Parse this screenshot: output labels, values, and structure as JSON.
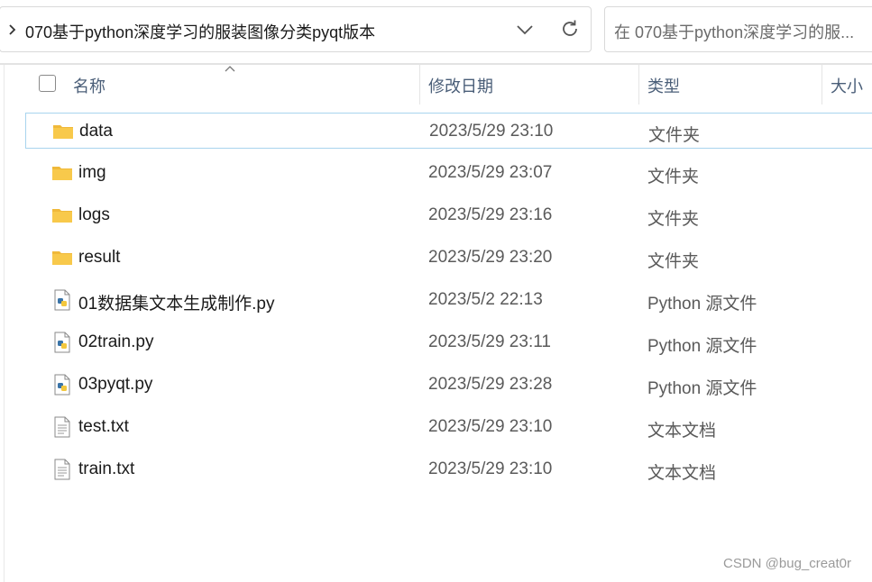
{
  "address": {
    "path": "070基于python深度学习的服装图像分类pyqt版本"
  },
  "search": {
    "placeholder": "在 070基于python深度学习的服..."
  },
  "columns": {
    "name": "名称",
    "modified": "修改日期",
    "type": "类型",
    "size": "大小"
  },
  "files": [
    {
      "name": "data",
      "modified": "2023/5/29 23:10",
      "type": "文件夹",
      "icon": "folder-icon"
    },
    {
      "name": "img",
      "modified": "2023/5/29 23:07",
      "type": "文件夹",
      "icon": "folder-icon"
    },
    {
      "name": "logs",
      "modified": "2023/5/29 23:16",
      "type": "文件夹",
      "icon": "folder-icon"
    },
    {
      "name": "result",
      "modified": "2023/5/29 23:20",
      "type": "文件夹",
      "icon": "folder-icon"
    },
    {
      "name": "01数据集文本生成制作.py",
      "modified": "2023/5/2 22:13",
      "type": "Python 源文件",
      "icon": "python-file-icon"
    },
    {
      "name": "02train.py",
      "modified": "2023/5/29 23:11",
      "type": "Python 源文件",
      "icon": "python-file-icon"
    },
    {
      "name": "03pyqt.py",
      "modified": "2023/5/29 23:28",
      "type": "Python 源文件",
      "icon": "python-file-icon"
    },
    {
      "name": "test.txt",
      "modified": "2023/5/29 23:10",
      "type": "文本文档",
      "icon": "text-file-icon"
    },
    {
      "name": "train.txt",
      "modified": "2023/5/29 23:10",
      "type": "文本文档",
      "icon": "text-file-icon"
    }
  ],
  "watermark": "CSDN @bug_creat0r",
  "colors": {
    "folder": "#f8c94b",
    "selection_border": "#a8d4ee",
    "header_text": "#4a5e78"
  }
}
